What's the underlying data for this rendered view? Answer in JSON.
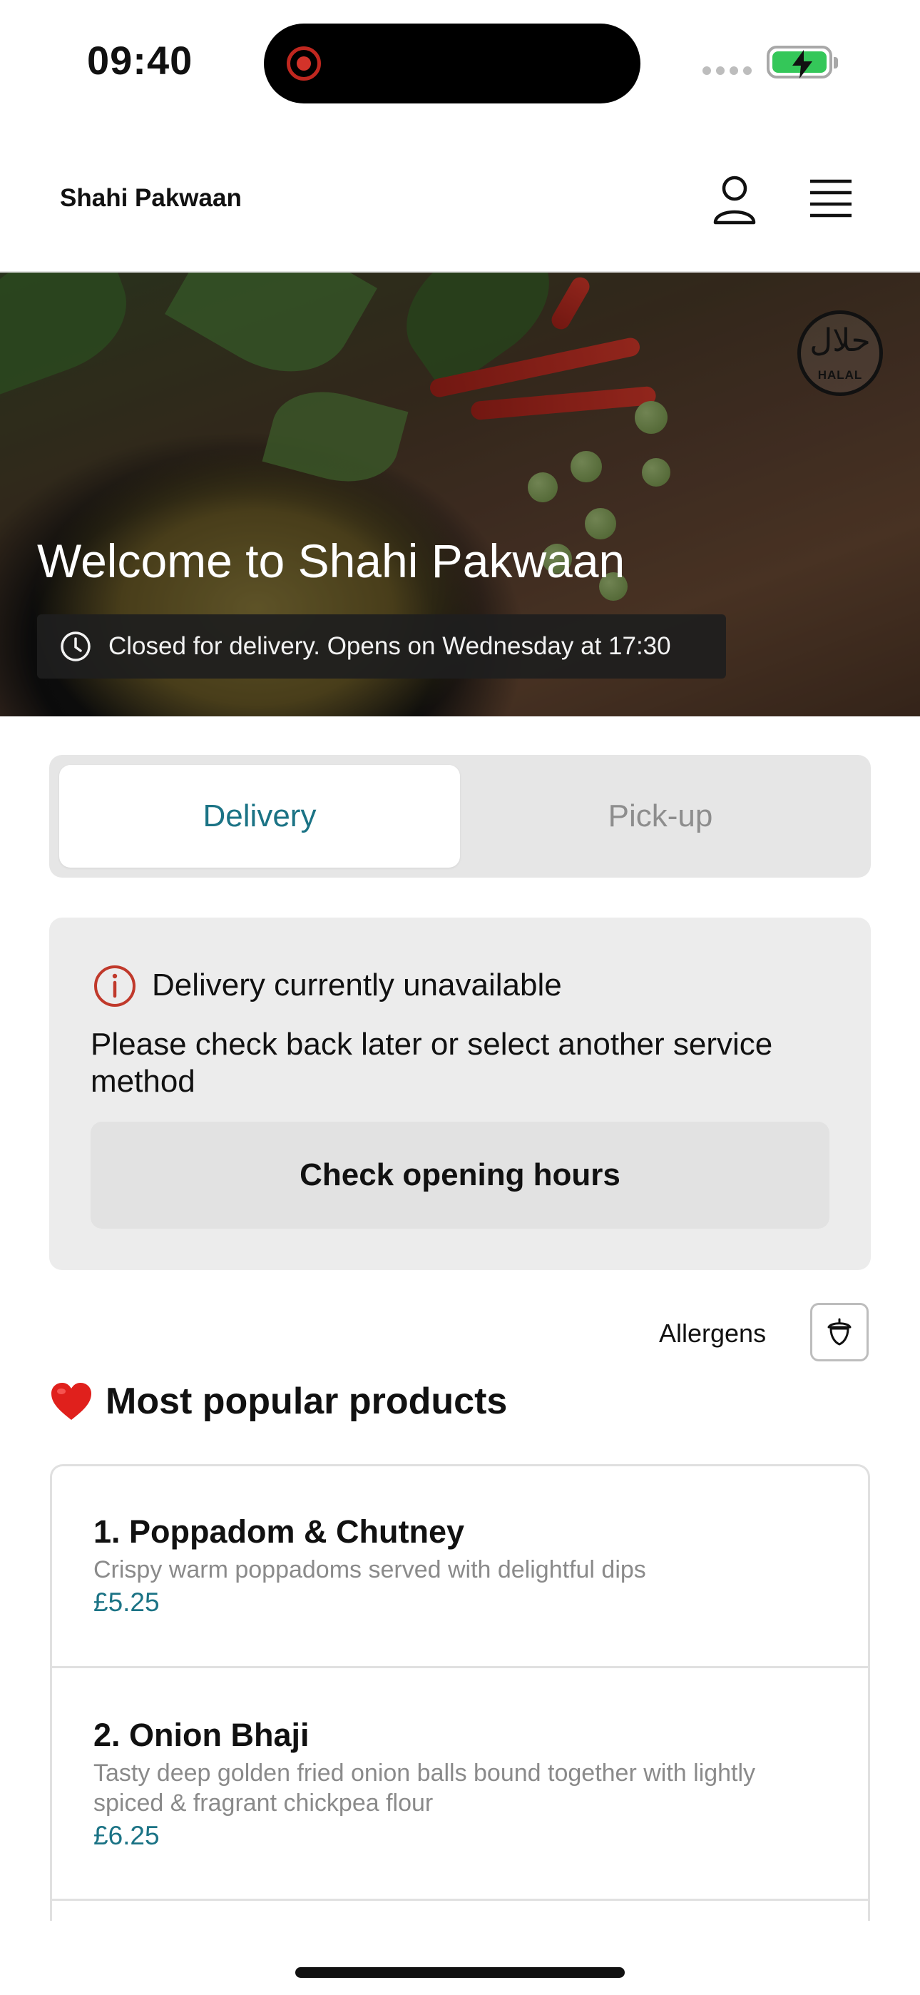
{
  "status_bar": {
    "time": "09:40"
  },
  "header": {
    "brand": "Shahi Pakwaan"
  },
  "hero": {
    "title": "Welcome to Shahi Pakwaan",
    "status": "Closed for delivery. Opens on Wednesday at 17:30",
    "badge_arabic": "حلال",
    "badge_latin": "HALAL"
  },
  "service_toggle": {
    "options": [
      "Delivery",
      "Pick-up"
    ],
    "selected": "Delivery"
  },
  "notice": {
    "title": "Delivery currently unavailable",
    "body": "Please check back later or select another service method",
    "button": "Check opening hours"
  },
  "allergens": {
    "label": "Allergens"
  },
  "popular": {
    "title": "Most popular products",
    "products": [
      {
        "name": "1. Poppadom & Chutney",
        "description": "Crispy warm poppadoms served with delightful dips",
        "price": "£5.25"
      },
      {
        "name": "2. Onion Bhaji",
        "description": "Tasty deep golden fried onion balls bound together with lightly spiced & fragrant chickpea flour",
        "price": "£6.25"
      }
    ]
  },
  "colors": {
    "accent": "#1b7385",
    "alert": "#c0392b",
    "heart": "#e0201c",
    "battery": "#34c759"
  }
}
